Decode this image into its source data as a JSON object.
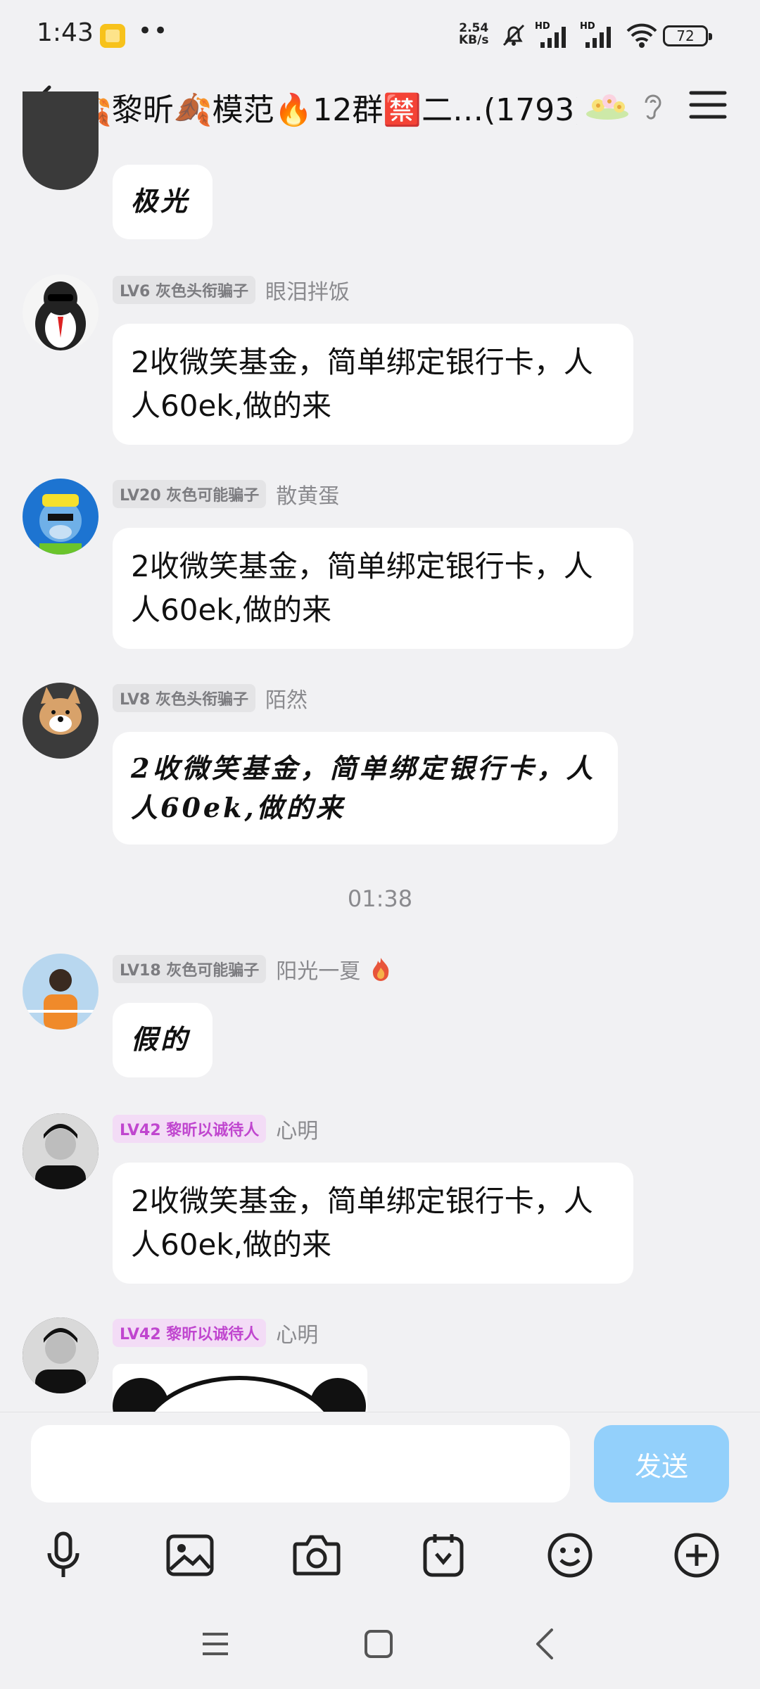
{
  "status_bar": {
    "time": "1:43",
    "dots": "••",
    "speed_value": "2.54",
    "speed_unit": "KB/s",
    "net1": "HD",
    "net2": "HD",
    "battery": "72"
  },
  "header": {
    "title": "🍂黎昕🍂模范🔥12群🈲二…(1793)"
  },
  "messages": [
    {
      "text": "极光"
    },
    {
      "badge": "LV6 灰色头衔骗子",
      "name": "眼泪拌饭",
      "text": "2收微笑基金，简单绑定银行卡，人人60ek,做的来"
    },
    {
      "badge": "LV20 灰色可能骗子",
      "name": "散黄蛋",
      "text": "2收微笑基金，简单绑定银行卡，人人60ek,做的来"
    },
    {
      "badge": "LV8 灰色头衔骗子",
      "name": "陌然",
      "text": "2收微笑基金，简单绑定银行卡，人人60ek,做的来"
    },
    {
      "badge": "LV18 灰色可能骗子",
      "name": "阳光一夏",
      "text": "假的"
    },
    {
      "badge": "LV42 黎昕以诚待人",
      "name": "心明",
      "text": "2收微笑基金，简单绑定银行卡，人人60ek,做的来"
    },
    {
      "badge": "LV42 黎昕以诚待人",
      "name": "心明"
    }
  ],
  "timestamp": "01:38",
  "input": {
    "placeholder": "",
    "send_label": "发送"
  },
  "colors": {
    "accent": "#93d0fb",
    "purple_badge": "#c046cf",
    "background": "#f1f1f3"
  },
  "icons": [
    "back-icon",
    "ear-icon",
    "menu-icon",
    "mic-icon",
    "image-icon",
    "camera-icon",
    "sticker-icon",
    "emoji-icon",
    "plus-icon"
  ]
}
